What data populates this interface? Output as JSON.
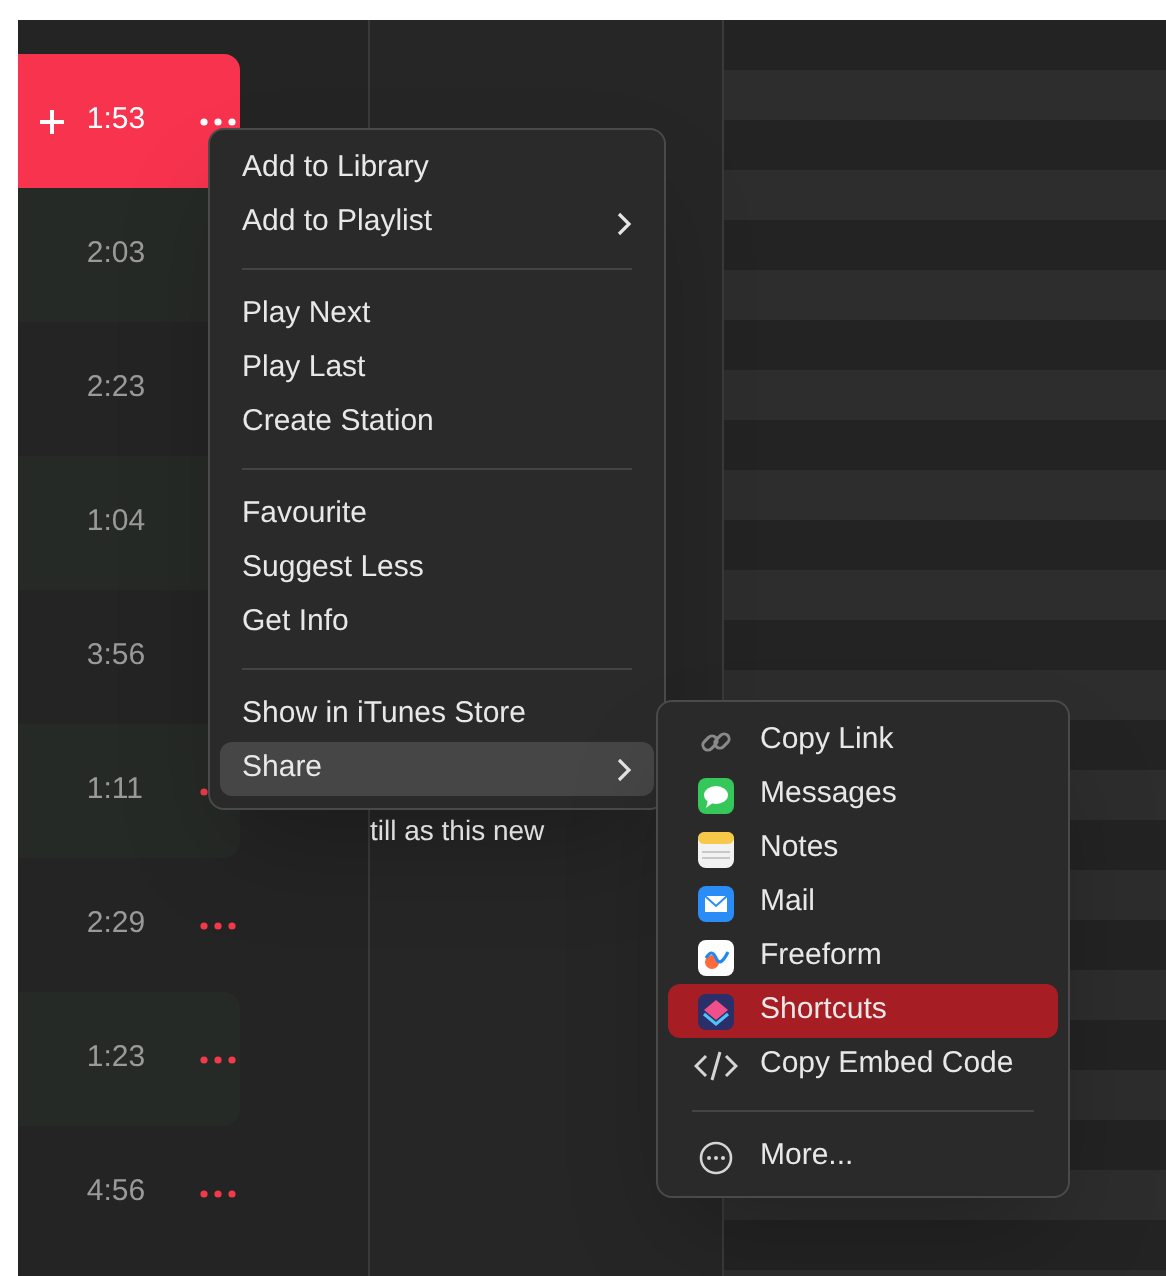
{
  "tracks": [
    {
      "duration": "1:53",
      "selected": true,
      "more_shown": true
    },
    {
      "duration": "2:03",
      "selected": false,
      "more_shown": false
    },
    {
      "duration": "2:23",
      "selected": false,
      "more_shown": false
    },
    {
      "duration": "1:04",
      "selected": false,
      "more_shown": false
    },
    {
      "duration": "3:56",
      "selected": false,
      "more_shown": false
    },
    {
      "duration": "1:11",
      "selected": false,
      "more_shown": true
    },
    {
      "duration": "2:29",
      "selected": false,
      "more_shown": true
    },
    {
      "duration": "1:23",
      "selected": false,
      "more_shown": true
    },
    {
      "duration": "4:56",
      "selected": false,
      "more_shown": true
    }
  ],
  "middle_text": "till as this new",
  "context_menu": {
    "items": [
      {
        "kind": "item",
        "label": "Add to Library"
      },
      {
        "kind": "submenu",
        "label": "Add to Playlist",
        "selected": false
      },
      {
        "kind": "separator"
      },
      {
        "kind": "item",
        "label": "Play Next"
      },
      {
        "kind": "item",
        "label": "Play Last"
      },
      {
        "kind": "item",
        "label": "Create Station"
      },
      {
        "kind": "separator"
      },
      {
        "kind": "item",
        "label": "Favourite"
      },
      {
        "kind": "item",
        "label": "Suggest Less"
      },
      {
        "kind": "item",
        "label": "Get Info"
      },
      {
        "kind": "separator"
      },
      {
        "kind": "item",
        "label": "Show in iTunes Store"
      },
      {
        "kind": "submenu",
        "label": "Share",
        "selected": true
      }
    ]
  },
  "share_menu": {
    "items": [
      {
        "kind": "item",
        "label": "Copy Link",
        "selected": false
      },
      {
        "kind": "item",
        "label": "Messages",
        "selected": false
      },
      {
        "kind": "item",
        "label": "Notes",
        "selected": false
      },
      {
        "kind": "item",
        "label": "Mail",
        "selected": false
      },
      {
        "kind": "item",
        "label": "Freeform",
        "selected": false
      },
      {
        "kind": "item",
        "label": "Shortcuts",
        "selected": true
      },
      {
        "kind": "item",
        "label": "Copy Embed Code",
        "selected": false
      },
      {
        "kind": "separator"
      },
      {
        "kind": "item",
        "label": "More...",
        "selected": false
      }
    ]
  }
}
